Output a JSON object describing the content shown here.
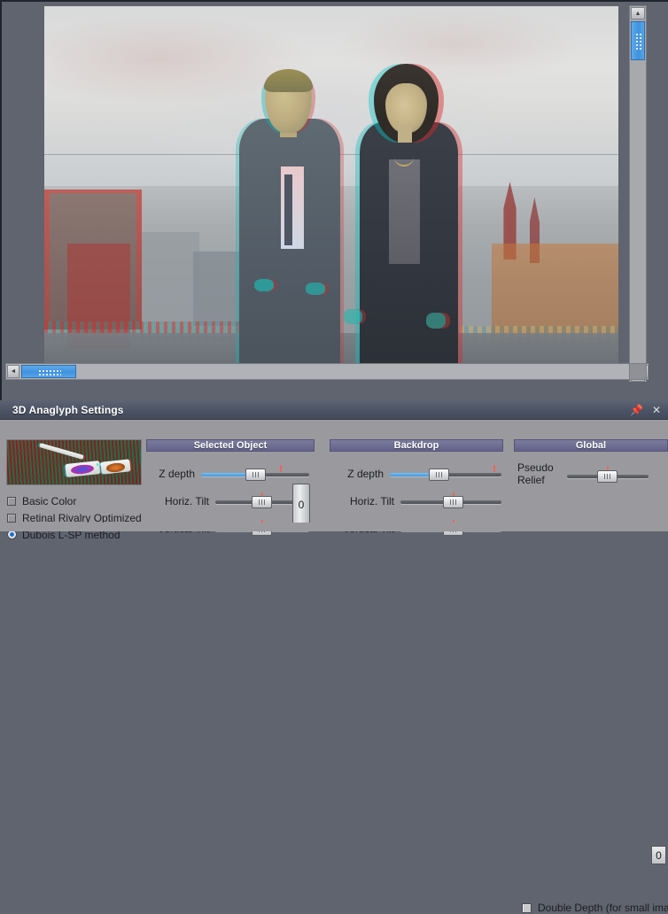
{
  "window": {
    "panel_title": "3D Anaglyph Settings",
    "pin_icon": "pin-icon",
    "close_icon": "close-icon"
  },
  "viewer": {
    "image_description": "Anaglyph 3D photograph of a man and a woman standing on a rooftop terrace with a city skyline and overcast sky behind them",
    "vertical_scrollbar": {
      "up_arrow": "▲",
      "down_arrow": "▼"
    },
    "horizontal_scrollbar": {
      "left_arrow": "◄",
      "right_arrow": "►"
    }
  },
  "panel": {
    "preview_thumbnail": "anaglyph-glasses-thumbnail",
    "methods": [
      {
        "id": "basic-color",
        "label": "Basic Color",
        "type": "checkbox",
        "checked": false
      },
      {
        "id": "retinal-rivalry-optimized",
        "label": "Retinal Rivalry Optimized",
        "type": "checkbox",
        "checked": false
      },
      {
        "id": "dubois-lsp",
        "label": "Dubois L-SP method",
        "type": "radio",
        "checked": true
      }
    ],
    "sections": {
      "selected_object": {
        "title": "Selected Object",
        "sliders": [
          {
            "label": "Z depth",
            "thumb_pct": 50,
            "fill_pct": 50,
            "tick_pct": 73,
            "has_fill": true
          },
          {
            "label": "Horiz. Tilt",
            "thumb_pct": 49,
            "fill_pct": 0,
            "tick_pct": 49,
            "has_fill": false
          },
          {
            "label": "Vertical Tilt",
            "thumb_pct": 49,
            "fill_pct": 0,
            "tick_pct": 49,
            "has_fill": false
          }
        ],
        "value_box": "0"
      },
      "backdrop": {
        "title": "Backdrop",
        "sliders": [
          {
            "label": "Z depth",
            "thumb_pct": 44,
            "fill_pct": 44,
            "tick_pct": 93,
            "has_fill": true
          },
          {
            "label": "Horiz. Tilt",
            "thumb_pct": 52,
            "fill_pct": 0,
            "tick_pct": 52,
            "has_fill": false
          },
          {
            "label": "Vertical Tilt",
            "thumb_pct": 52,
            "fill_pct": 0,
            "tick_pct": 52,
            "has_fill": false
          }
        ]
      },
      "global": {
        "title": "Global",
        "sliders": [
          {
            "label": "Pseudo\nRelief",
            "thumb_pct": 49,
            "fill_pct": 0,
            "tick_pct": 49,
            "has_fill": false
          }
        ],
        "value_box": "0",
        "double_depth": {
          "label": "Double Depth (for small image",
          "checked": false
        }
      }
    }
  },
  "colors": {
    "panel_background": "#9a9a9e",
    "title_bar": "#4c5364",
    "section_header": "#6b6b8c",
    "slider_fill": "#3f93e2",
    "slider_tick": "#e8675f",
    "scrollbar_thumb": "#3f92e0",
    "radio_dot": "#1f6fd0",
    "viewer_background": "#60646f"
  }
}
